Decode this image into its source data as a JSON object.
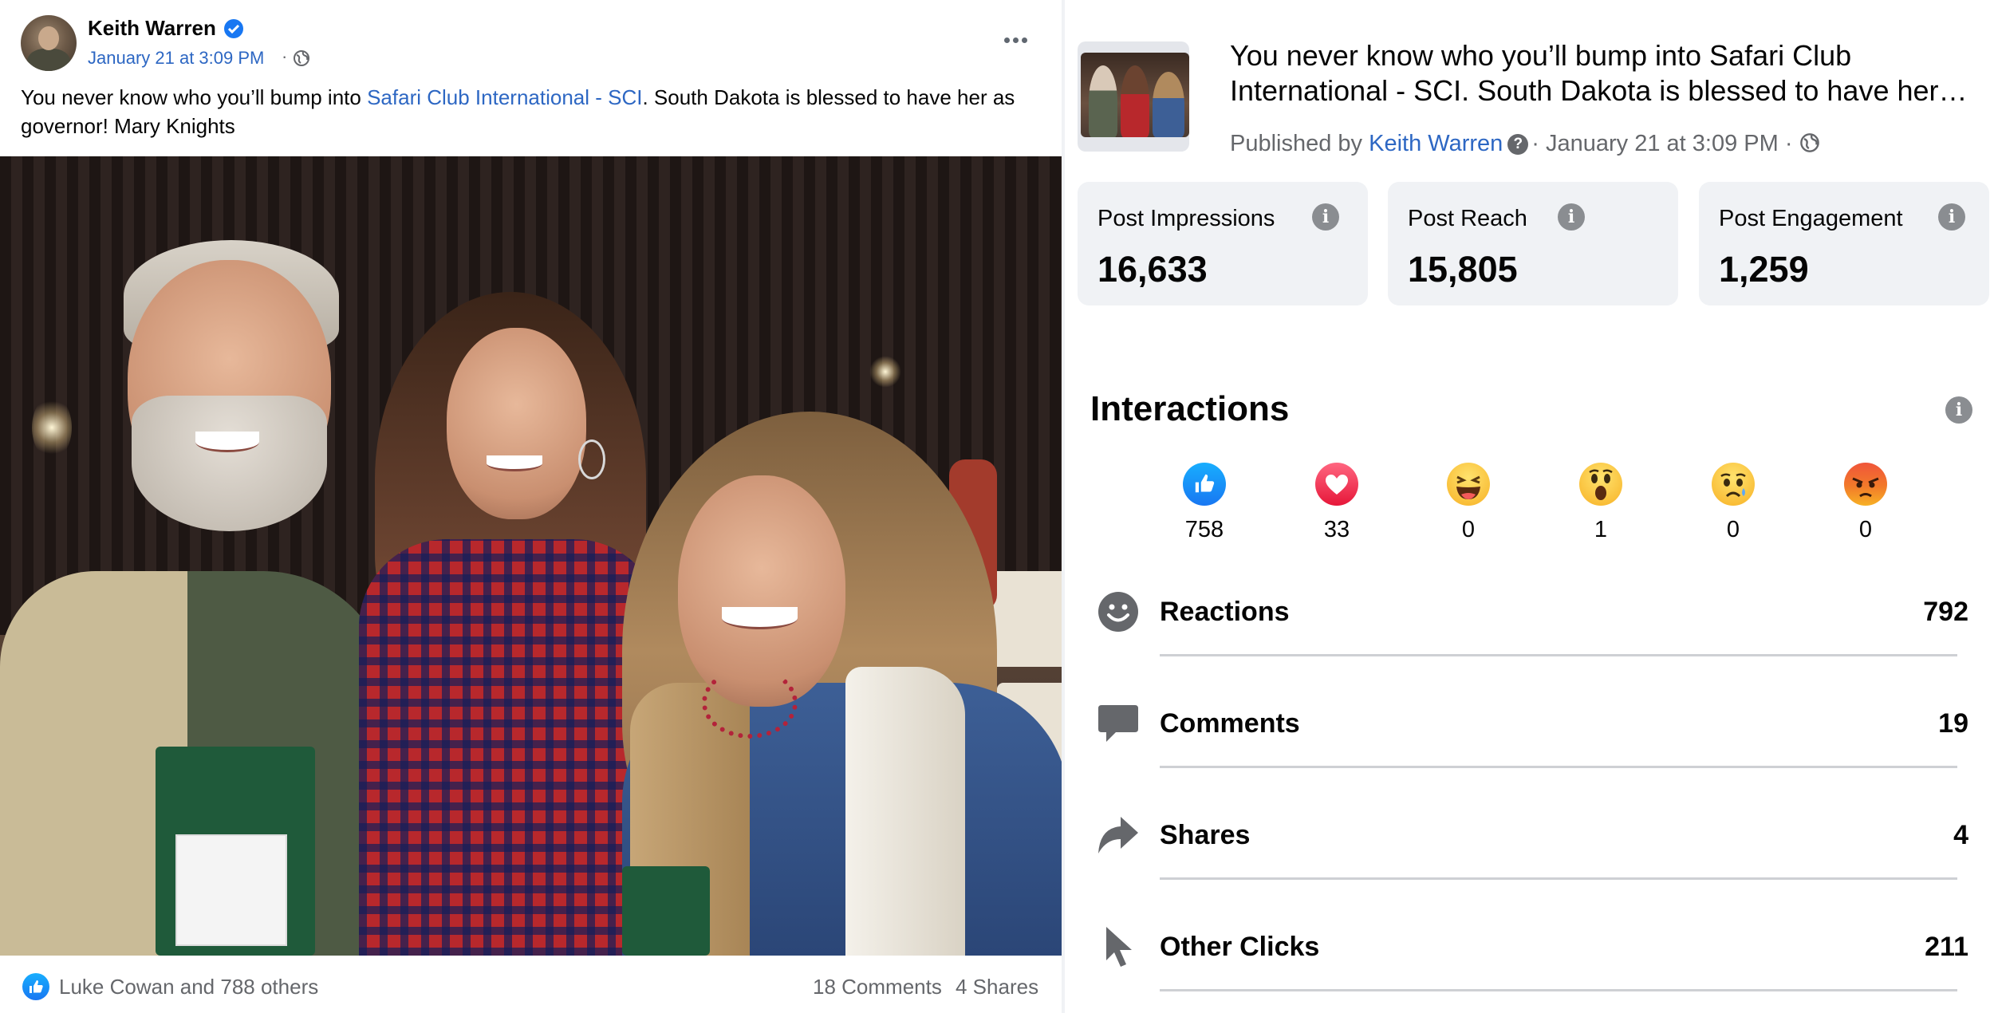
{
  "post": {
    "author": "Keith Warren",
    "date": "January 21 at 3:09 PM",
    "date_dot": "·",
    "text_before": "You never know who you’ll bump into ",
    "text_link": "Safari Club International - SCI",
    "text_after": ". South Dakota is blessed to have her as governor! Mary Knights",
    "likers": "Luke Cowan and 788 others",
    "comments": "18 Comments",
    "shares": "4 Shares"
  },
  "insights": {
    "headline": "You never know who you’ll bump into Safari Club International - SCI. South Dakota is blessed to have her as governor! Mary Knights",
    "published_prefix": "Published by ",
    "published_name": "Keith Warren",
    "published_sep": "·",
    "published_date": "January 21 at 3:09 PM",
    "published_dot": "·",
    "help_glyph": "?",
    "info_glyph": "i",
    "stats": [
      {
        "label": "Post Impressions",
        "value": "16,633"
      },
      {
        "label": "Post Reach",
        "value": "15,805"
      },
      {
        "label": "Post Engagement",
        "value": "1,259"
      }
    ],
    "interactions_title": "Interactions",
    "reactions": [
      {
        "icon": "like-icon",
        "count": "758"
      },
      {
        "icon": "love-icon",
        "count": "33"
      },
      {
        "icon": "haha-icon",
        "count": "0"
      },
      {
        "icon": "wow-icon",
        "count": "1"
      },
      {
        "icon": "sad-icon",
        "count": "0"
      },
      {
        "icon": "angry-icon",
        "count": "0"
      }
    ],
    "metrics": [
      {
        "icon": "smiley-icon",
        "label": "Reactions",
        "value": "792"
      },
      {
        "icon": "comment-icon",
        "label": "Comments",
        "value": "19"
      },
      {
        "icon": "share-icon",
        "label": "Shares",
        "value": "4"
      },
      {
        "icon": "cursor-icon",
        "label": "Other Clicks",
        "value": "211"
      }
    ]
  },
  "colors": {
    "link": "#2d67c3",
    "muted": "#65676b",
    "card_bg": "#f0f2f5",
    "facebook_blue": "#1877f2",
    "love_red": "#f33e58",
    "emoji_yellow": "#f7b125",
    "angry_orange": "#e9710f"
  }
}
